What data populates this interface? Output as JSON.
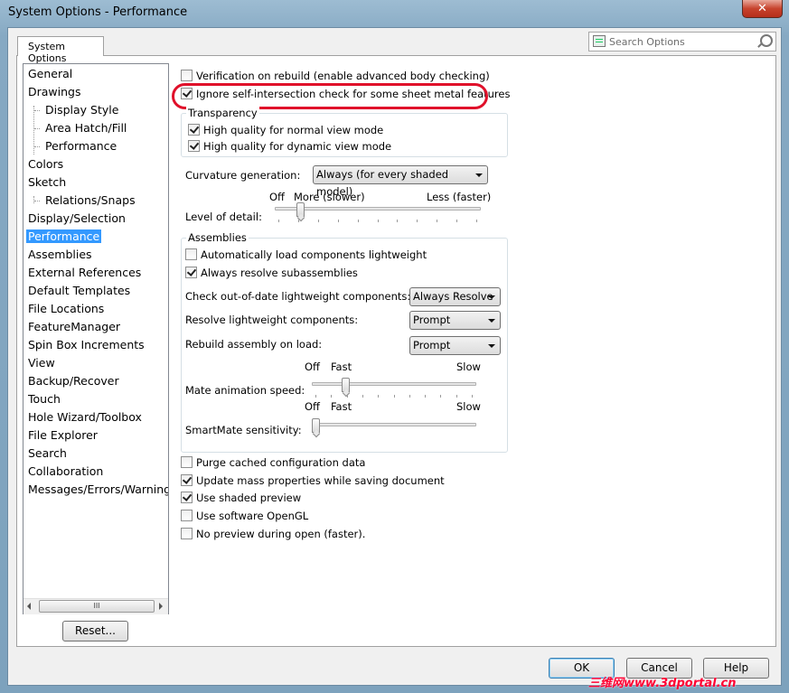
{
  "window": {
    "title": "System Options - Performance",
    "close_glyph": "✕"
  },
  "tab": {
    "label": "System Options"
  },
  "search": {
    "placeholder": "Search Options"
  },
  "tree": {
    "items": [
      {
        "label": "General",
        "indent": 0
      },
      {
        "label": "Drawings",
        "indent": 0
      },
      {
        "label": "Display Style",
        "indent": 1
      },
      {
        "label": "Area Hatch/Fill",
        "indent": 1
      },
      {
        "label": "Performance",
        "indent": 1
      },
      {
        "label": "Colors",
        "indent": 0
      },
      {
        "label": "Sketch",
        "indent": 0
      },
      {
        "label": "Relations/Snaps",
        "indent": 1
      },
      {
        "label": "Display/Selection",
        "indent": 0
      },
      {
        "label": "Performance",
        "indent": 0,
        "selected": true
      },
      {
        "label": "Assemblies",
        "indent": 0
      },
      {
        "label": "External References",
        "indent": 0
      },
      {
        "label": "Default Templates",
        "indent": 0
      },
      {
        "label": "File Locations",
        "indent": 0
      },
      {
        "label": "FeatureManager",
        "indent": 0
      },
      {
        "label": "Spin Box Increments",
        "indent": 0
      },
      {
        "label": "View",
        "indent": 0
      },
      {
        "label": "Backup/Recover",
        "indent": 0
      },
      {
        "label": "Touch",
        "indent": 0
      },
      {
        "label": "Hole Wizard/Toolbox",
        "indent": 0
      },
      {
        "label": "File Explorer",
        "indent": 0
      },
      {
        "label": "Search",
        "indent": 0
      },
      {
        "label": "Collaboration",
        "indent": 0
      },
      {
        "label": "Messages/Errors/Warnings",
        "indent": 0
      }
    ],
    "scroll_thumb": "III"
  },
  "reset_button": "Reset...",
  "options": {
    "verification": {
      "label": "Verification on rebuild (enable advanced body checking)",
      "checked": false
    },
    "ignore_self_intersection": {
      "label": "Ignore self-intersection check for some sheet metal features",
      "checked": true
    }
  },
  "transparency": {
    "title": "Transparency",
    "normal": {
      "label": "High quality for normal view mode",
      "checked": true
    },
    "dynamic": {
      "label": "High quality for dynamic view mode",
      "checked": true
    }
  },
  "curvature": {
    "label": "Curvature generation:",
    "value": "Always (for every shaded model)"
  },
  "level_of_detail": {
    "label": "Level of detail:",
    "off": "Off",
    "more": "More (slower)",
    "less": "Less (faster)",
    "value_fraction": 0.11
  },
  "assemblies": {
    "title": "Assemblies",
    "auto_lightweight": {
      "label": "Automatically load components lightweight",
      "checked": false
    },
    "resolve_sub": {
      "label": "Always resolve subassemblies",
      "checked": true
    },
    "check_out_of_date": {
      "label": "Check out-of-date lightweight components:",
      "value": "Always Resolve"
    },
    "resolve_lightweight": {
      "label": "Resolve lightweight components:",
      "value": "Prompt"
    },
    "rebuild_on_load": {
      "label": "Rebuild assembly on load:",
      "value": "Prompt"
    },
    "mate_animation": {
      "label": "Mate animation speed:",
      "off": "Off",
      "fast": "Fast",
      "slow": "Slow",
      "value_fraction": 0.19
    },
    "smartmate": {
      "label": "SmartMate sensitivity:",
      "off": "Off",
      "fast": "Fast",
      "slow": "Slow",
      "value_fraction": 0.0
    }
  },
  "bottom_options": {
    "purge": {
      "label": "Purge cached configuration data",
      "checked": false
    },
    "mass_props": {
      "label": "Update mass properties while saving document",
      "checked": true
    },
    "shaded_preview": {
      "label": "Use shaded preview",
      "checked": true
    },
    "software_opengl": {
      "label": "Use software OpenGL",
      "checked": false
    },
    "no_preview": {
      "label": "No preview during open (faster).",
      "checked": false
    }
  },
  "buttons": {
    "ok": "OK",
    "cancel": "Cancel",
    "help": "Help"
  },
  "watermark": "三维网www.3dportal.cn",
  "colors": {
    "selection": "#3399ff",
    "highlight_ellipse": "#e0102a"
  }
}
